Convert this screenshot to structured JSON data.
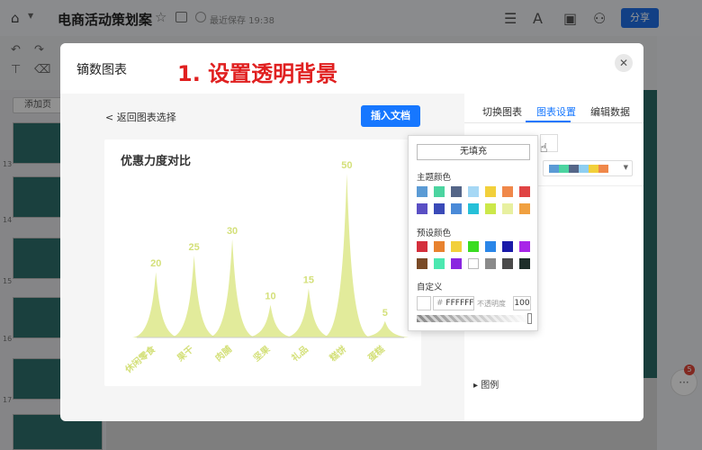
{
  "app": {
    "doc_title": "电商活动策划案",
    "save_status": "最近保存 19:38",
    "share_label": "分享",
    "add_page_label": "添加页",
    "thumb_numbers": [
      "13",
      "14",
      "15",
      "16",
      "17"
    ],
    "badge_count": "5"
  },
  "modal": {
    "title": "镝数图表",
    "step_title": "1. 设置透明背景",
    "back_label": "返回图表选择",
    "insert_label": "插入文档",
    "close_icon": "close-icon"
  },
  "settings": {
    "tabs": [
      {
        "label": "切换图表",
        "active": false
      },
      {
        "label": "图表设置",
        "active": true
      },
      {
        "label": "编辑数据",
        "active": false
      }
    ],
    "palette": [
      "#5b9bd5",
      "#4cd4a0",
      "#556688",
      "#8ecff2",
      "#f2d03b",
      "#f0884a"
    ],
    "legend_label": "图例"
  },
  "color_picker": {
    "no_fill_label": "无填充",
    "theme_label": "主题颜色",
    "theme_colors": [
      [
        "#5b9bd5",
        "#4cd4a0",
        "#556688",
        "#a6d8f5",
        "#f2d03b",
        "#f0884a",
        "#e04444"
      ],
      [
        "#5a4fc4",
        "#3a4ab8",
        "#4a8ad8",
        "#26c0d8",
        "#cce84a",
        "#e8f0a0",
        "#f0a040"
      ]
    ],
    "preset_label": "预设颜色",
    "preset_colors": [
      [
        "#d42f3c",
        "#e8822f",
        "#f2d03b",
        "#3adc22",
        "#2a86e8",
        "#1a1aa8",
        "#a826e8"
      ],
      [
        "#7a4a26",
        "#4ce8b0",
        "#8a26e0",
        "#ffffff",
        "#8a8a8a",
        "#4a4a4a",
        "#1e2e2a"
      ]
    ],
    "custom_label": "自定义",
    "hex_value": "FFFFFF",
    "opacity_label": "不透明度",
    "opacity_value": "100"
  },
  "chart_data": {
    "type": "area",
    "title": "优惠力度对比",
    "categories": [
      "休闲零食",
      "果干",
      "肉脯",
      "坚果",
      "礼品",
      "糕饼",
      "蛋糕"
    ],
    "values": [
      20,
      25,
      30,
      10,
      15,
      50,
      5
    ],
    "color": "#dde88a",
    "label_color": "#d4e07a"
  }
}
